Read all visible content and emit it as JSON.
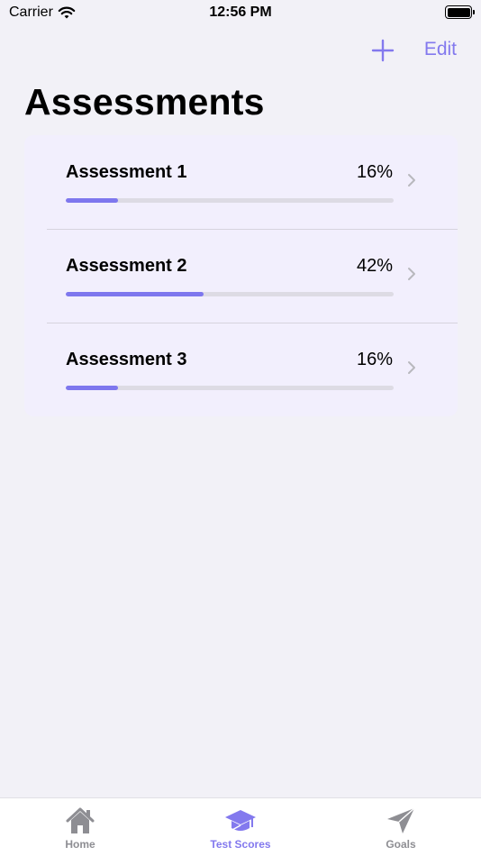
{
  "status_bar": {
    "carrier": "Carrier",
    "time": "12:56 PM"
  },
  "nav": {
    "add_icon": "plus-icon",
    "edit_label": "Edit",
    "title": "Assessments"
  },
  "assessments": [
    {
      "title": "Assessment 1",
      "percent_label": "16%",
      "progress": 0.16
    },
    {
      "title": "Assessment 2",
      "percent_label": "42%",
      "progress": 0.42
    },
    {
      "title": "Assessment 3",
      "percent_label": "16%",
      "progress": 0.16
    }
  ],
  "tabs": [
    {
      "label": "Home",
      "icon": "house-icon",
      "selected": false
    },
    {
      "label": "Test Scores",
      "icon": "graduation-cap-icon",
      "selected": true
    },
    {
      "label": "Goals",
      "icon": "paper-plane-icon",
      "selected": false
    }
  ],
  "colors": {
    "accent": "#8379ee",
    "progress_fill": "#7e77ee",
    "progress_track": "#dddbe4",
    "background": "#f2f1f7",
    "card": "#f2effd",
    "tab_inactive": "#8e8e93"
  }
}
